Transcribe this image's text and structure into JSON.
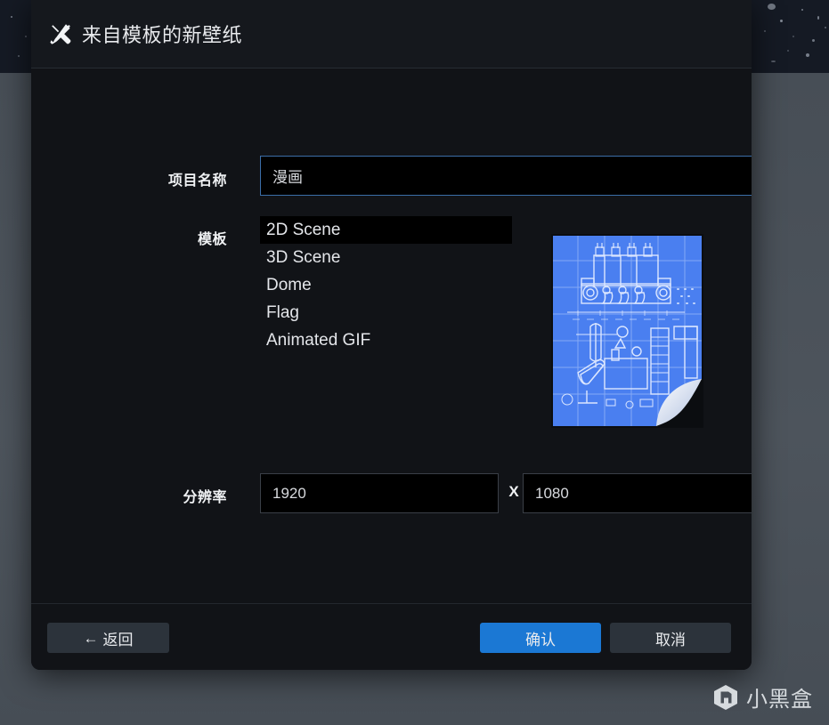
{
  "window": {
    "title": "来自模板的新壁纸",
    "title_icon": "crossed-tools-icon"
  },
  "form": {
    "project_name": {
      "label": "项目名称",
      "value": "漫画",
      "placeholder": "",
      "border_color": "#3b6ea8"
    },
    "template": {
      "label": "模板",
      "options": [
        "2D Scene",
        "3D Scene",
        "Dome",
        "Flag",
        "Animated GIF"
      ],
      "selected": "2D Scene",
      "thumbnail_name": "blueprint-page-curl-thumbnail",
      "thumbnail_colors": {
        "paper": "#4a7ff0",
        "ink": "#cfe0ff",
        "curl": "#e8eefb"
      }
    },
    "resolution": {
      "label": "分辨率",
      "width": "1920",
      "separator": "X",
      "height": "1080"
    }
  },
  "footer": {
    "back_arrow": "←",
    "back_label": "返回",
    "confirm_label": "确认",
    "cancel_label": "取消",
    "confirm_color": "#1b78d4"
  },
  "watermark": {
    "text": "小黑盒",
    "logo": "hexagon-logo-icon"
  }
}
